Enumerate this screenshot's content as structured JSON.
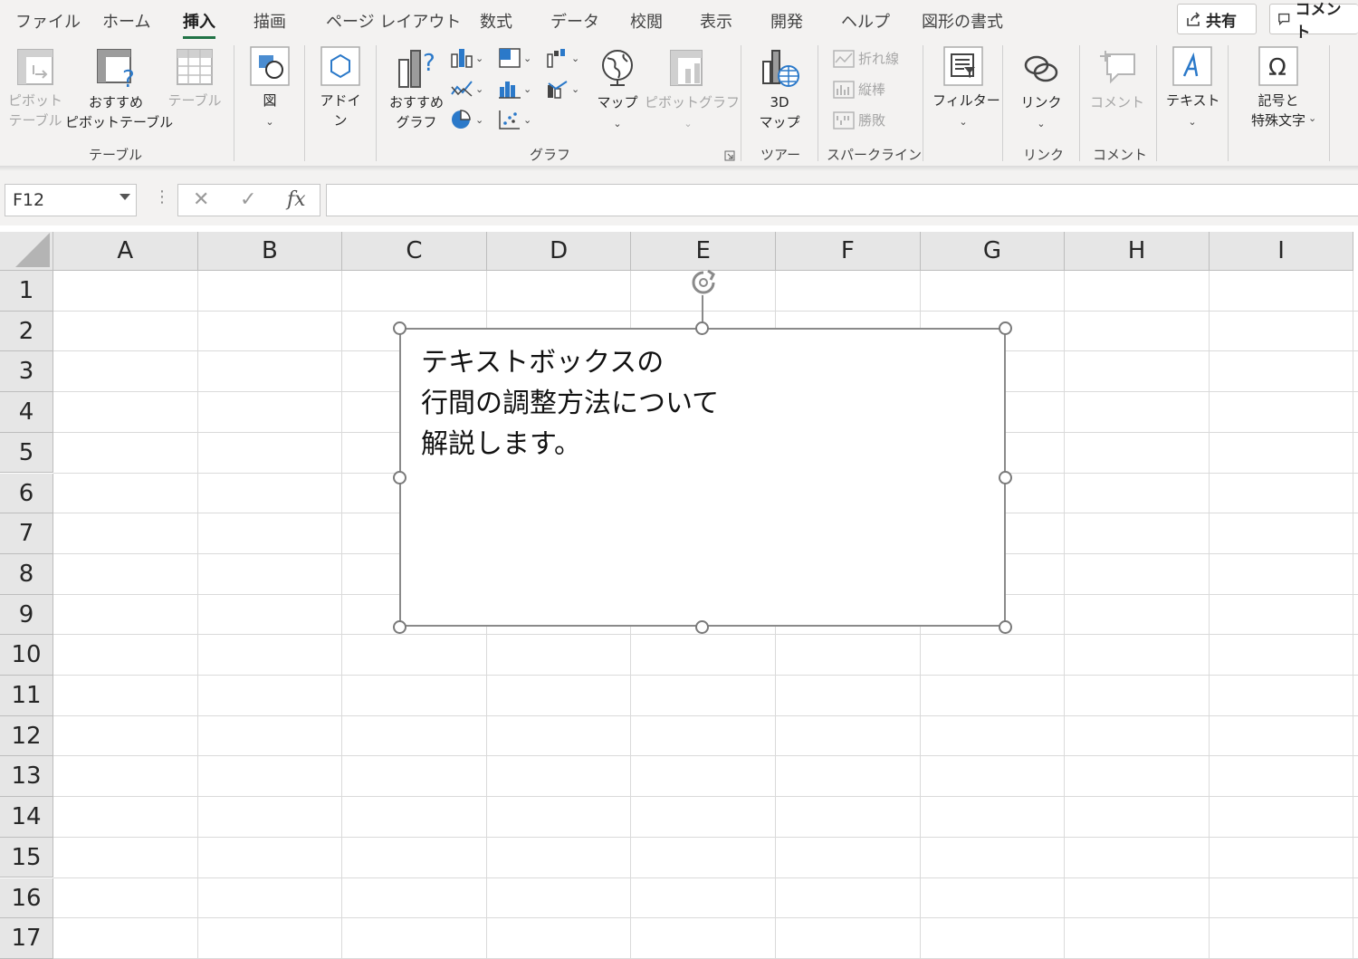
{
  "menu": {
    "tabs": [
      {
        "id": "file",
        "label": "ファイル"
      },
      {
        "id": "home",
        "label": "ホーム"
      },
      {
        "id": "insert",
        "label": "挿入"
      },
      {
        "id": "draw",
        "label": "描画"
      },
      {
        "id": "page_layout",
        "label": "ページ レイアウト"
      },
      {
        "id": "formulas",
        "label": "数式"
      },
      {
        "id": "data",
        "label": "データ"
      },
      {
        "id": "review",
        "label": "校閲"
      },
      {
        "id": "view",
        "label": "表示"
      },
      {
        "id": "developer",
        "label": "開発"
      },
      {
        "id": "help",
        "label": "ヘルプ"
      },
      {
        "id": "shape_format",
        "label": "図形の書式"
      }
    ],
    "active_tab": "挿入",
    "share_label": "共有",
    "comment_label": "コメント"
  },
  "ribbon": {
    "pivot_table": "ピボット\nテーブル",
    "recommended_pivot": "おすすめ\nピボットテーブル",
    "table": "テーブル",
    "group_tables": "テーブル",
    "illustrations": "図",
    "addins": "アドイ\nン",
    "recommended_charts": "おすすめ\nグラフ",
    "maps": "マップ",
    "pivot_chart": "ピボットグラフ",
    "group_charts": "グラフ",
    "map3d": "3D\nマップ",
    "group_tours": "ツアー",
    "spark_line": "折れ線",
    "spark_column": "縦棒",
    "spark_winloss": "勝敗",
    "group_sparklines": "スパークライン",
    "filter": "フィルター",
    "link": "リンク",
    "group_links": "リンク",
    "comment": "コメント",
    "group_comments": "コメント",
    "text": "テキスト",
    "symbols": "記号と\n特殊文字"
  },
  "formula_bar": {
    "name_box": "F12",
    "cancel": "✕",
    "enter": "✓",
    "fx": "fx",
    "formula": ""
  },
  "sheet": {
    "columns": [
      "A",
      "B",
      "C",
      "D",
      "E",
      "F",
      "G",
      "H",
      "I"
    ],
    "rows": [
      "1",
      "2",
      "3",
      "4",
      "5",
      "6",
      "7",
      "8",
      "9",
      "10",
      "11",
      "12",
      "13",
      "14",
      "15",
      "16",
      "17"
    ]
  },
  "textbox": {
    "text": "テキストボックスの\n行間の調整方法について\n解説します。"
  },
  "colors": {
    "accent": "#217346",
    "ribbon_bg": "#f3f2f1",
    "header_bg": "#e6e6e6",
    "icon_blue": "#2b79c9"
  }
}
